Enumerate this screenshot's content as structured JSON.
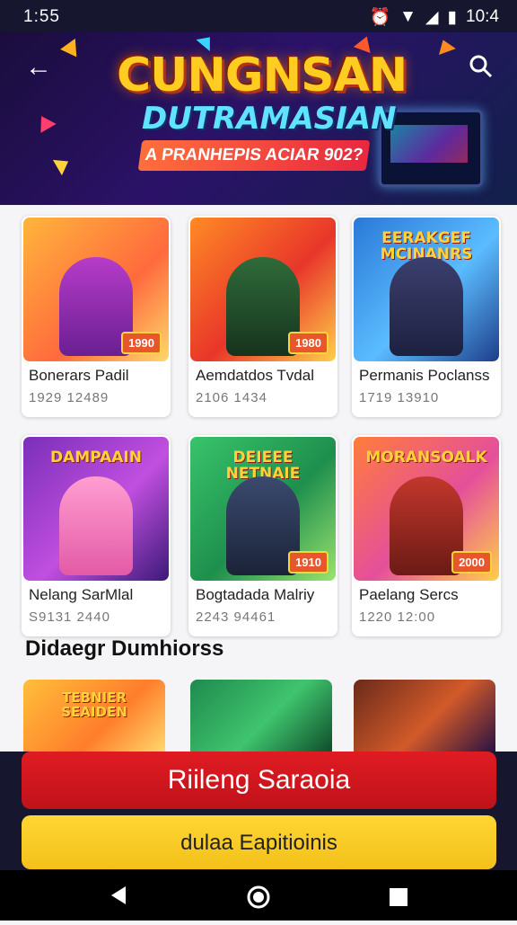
{
  "status_bar": {
    "time": "1:55",
    "right_time": "10:4"
  },
  "hero": {
    "title": "CUNGNSAN",
    "subtitle": "DUTRAMASIAN",
    "ribbon": "A PRANHEPIS ACIAR 902?"
  },
  "games": [
    {
      "name": "Bonerars Padil",
      "meta": "1929 12489",
      "badge": "1990",
      "art_title": ""
    },
    {
      "name": "Aemdatdos Tvdal",
      "meta": "2106 1434",
      "badge": "1980",
      "art_title": ""
    },
    {
      "name": "Permanis Poclanss",
      "meta": "1719 13910",
      "badge": "",
      "art_title": "EERAKGEF MCINANRS"
    },
    {
      "name": "Nelang SarMlal",
      "meta": "S9131 2440",
      "badge": "",
      "art_title": "DAMPAAIN"
    },
    {
      "name": "Bogtadada Malriy",
      "meta": "2243 94461",
      "badge": "1910",
      "art_title": "DEIEEE NETNAIE"
    },
    {
      "name": "Paelang Sercs",
      "meta": "1220 12:00",
      "badge": "2000",
      "art_title": "MORANSOALK"
    }
  ],
  "section": {
    "title": "Didaegr Dumhiorss"
  },
  "row3_art": [
    "TEBNIER SEAIDEN",
    "",
    ""
  ],
  "buttons": {
    "primary": "Riileng Saraoia",
    "secondary": "dulaa Eapitioinis"
  },
  "colors": {
    "primary": "#d2161d",
    "secondary": "#f8c823",
    "dark": "#16162e"
  }
}
